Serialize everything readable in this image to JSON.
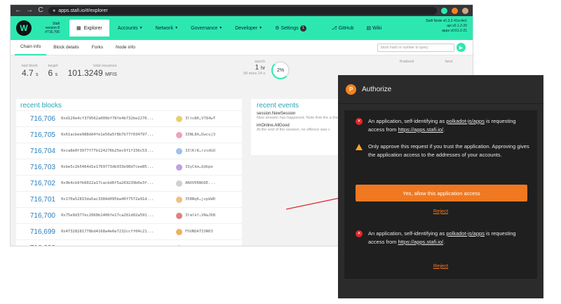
{
  "browser": {
    "back_glyph": "←",
    "forward_glyph": "→",
    "reload_glyph": "C",
    "url": "apps.stafi.io/#/explorer"
  },
  "header": {
    "logo_glyph": "W",
    "chain_lines": [
      "Stafi",
      "version 8",
      "#716,706"
    ],
    "tabs": [
      {
        "label": "Explorer",
        "active": true
      },
      {
        "label": "Accounts"
      },
      {
        "label": "Network"
      },
      {
        "label": "Governance"
      },
      {
        "label": "Developer"
      },
      {
        "label": "Settings",
        "badge": "1"
      },
      {
        "label": "GitHub"
      },
      {
        "label": "Wiki"
      }
    ],
    "node_info": [
      "Stafi Node v0.3.2-41cc4e1",
      "api v0.1.2-20",
      "apps v0.61.2-21"
    ]
  },
  "subtabs": [
    "Chain info",
    "Block details",
    "Forks",
    "Node info"
  ],
  "search": {
    "placeholder": "block hash or number to query"
  },
  "summary": {
    "last_block_label": "last block",
    "last_block_value": "4.7",
    "last_block_unit": "s",
    "target_label": "target",
    "target_value": "6",
    "target_unit": "s",
    "issuance_label": "total issuance",
    "issuance_value": "101.3249",
    "issuance_unit": "MFIS",
    "epoch_label": "epoch",
    "epoch_value": "1",
    "epoch_unit": "hr",
    "epoch_sub": "58 mins 24 s",
    "epoch_percent": "2%",
    "finalized_label": "finalized",
    "best_label": "best"
  },
  "recent_blocks": {
    "title": "recent blocks",
    "rows": [
      {
        "number": "716,706",
        "hash": "0xd129e4cf379562a009bf78fe4b732be2276...",
        "author": "3lto8R…VT84wT",
        "color": "#e8d070"
      },
      {
        "number": "716,705",
        "hash": "0x61acbee988dd4fe1e56a5f8b7b77f034797...",
        "author": "33NL8A…Dwcuj3",
        "color": "#f0a0c0"
      },
      {
        "number": "716,704",
        "hash": "0xca8e0f3977f77b124276b25ec9f1f156c53...",
        "author": "33lKr8…rzsdGU",
        "color": "#a0c0f0"
      },
      {
        "number": "716,703",
        "hash": "0xbe5c2b5464d1e1769773db933e98d7cee85...",
        "author": "33yCkm…Qdbpe",
        "color": "#c0a0e0"
      },
      {
        "number": "716,702",
        "hash": "0x9b4cb9fb6022a17cacbd6f5a269239b0e3f...",
        "author": "ANOVERNODE...",
        "color": "#d0d0d0"
      },
      {
        "number": "716,701",
        "hash": "0x170a52815da5ac3384d095ba40f7572a91d...",
        "author": "35BNq6…jvpkWD",
        "color": "#f0c080"
      },
      {
        "number": "716,700",
        "hash": "0x75e9d377ec2060b1406fe17ca261d02a591...",
        "author": "3lmlkf…VNaJ6B",
        "color": "#e08080"
      },
      {
        "number": "716,699",
        "hash": "0x47328281778bd4168a4e6e7232ccff04c21...",
        "author": "FOUNDATION03",
        "color": "#f0b060"
      },
      {
        "number": "716,698",
        "hash": "",
        "author": "",
        "color": "#e0e0e0"
      }
    ]
  },
  "recent_events": {
    "title": "recent events",
    "events": [
      {
        "name": "session.NewSession",
        "desc": "New session has happened. Note that the a the type might suggest."
      },
      {
        "name": "imOnline.AllGood",
        "desc": "At the end of the session, no offence was c"
      }
    ]
  },
  "dialog": {
    "title": "Authorize",
    "logo_glyph": "P",
    "request1_prefix": "An application, self-identifying as ",
    "request1_app": "polkadot-js/apps",
    "request1_mid": " is requesting access from ",
    "request1_url": "https://apps.stafi.io/",
    "request1_suffix": ".",
    "warning": "Only approve this request if you trust the application. Approving gives the application access to the addresses of your accounts.",
    "allow_label": "Yes, allow this application access",
    "reject_label": "Reject",
    "request2_prefix": "An application, self-identifying as ",
    "request2_app": "polkadot-js/apps",
    "request2_mid": " is requesting access from ",
    "request2_url": "https://apps.stafi.io/",
    "request2_suffix": ".",
    "reject2_label": "Reject"
  },
  "colors": {
    "accent": "#2ce8b0",
    "dialog_bg": "#2b2b2b",
    "allow": "#f07820",
    "arrow": "#e0262b"
  }
}
